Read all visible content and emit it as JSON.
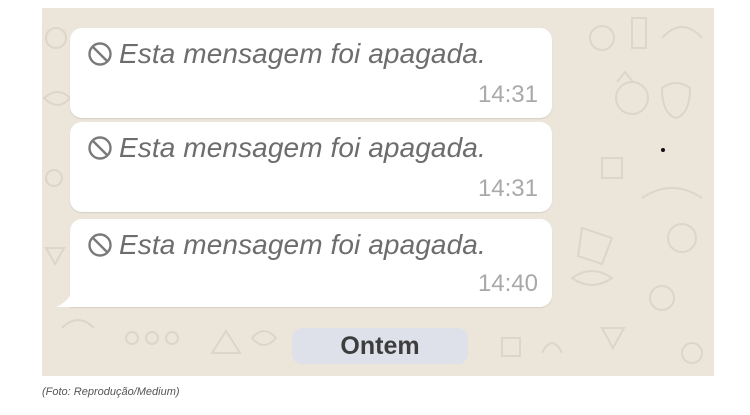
{
  "chat": {
    "messages": [
      {
        "text": "Esta mensagem foi apagada.",
        "time": "14:31",
        "icon": "ban-icon"
      },
      {
        "text": "Esta mensagem foi apagada.",
        "time": "14:31",
        "icon": "ban-icon"
      },
      {
        "text": "Esta mensagem foi apagada.",
        "time": "14:40",
        "icon": "ban-icon"
      }
    ],
    "date_separator": "Ontem"
  },
  "caption": "(Foto: Reprodução/Medium)",
  "colors": {
    "wallpaper": "#ece5da",
    "bubble": "#ffffff",
    "deleted_text": "#6d6d6d",
    "timestamp": "#a9a9a9",
    "date_pill": "#dfe1ea"
  }
}
